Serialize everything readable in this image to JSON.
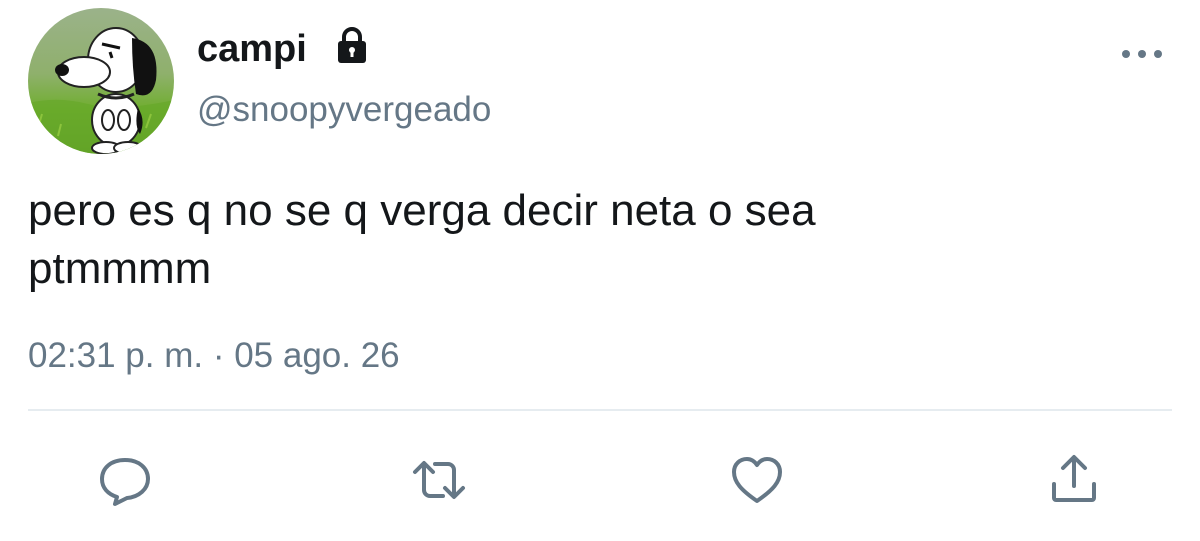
{
  "user": {
    "display_name": "campi",
    "handle": "@snoopyvergeado",
    "protected": true,
    "avatar": "snoopy-avatar"
  },
  "tweet": {
    "text": "pero es q no se q verga decir neta o sea\nptmmmm",
    "timestamp": "02:31 p. m. · 05 ago. 26"
  },
  "actions": {
    "icons": [
      "reply-icon",
      "retweet-icon",
      "like-icon",
      "share-icon"
    ]
  },
  "colors": {
    "primary_text": "#14171a",
    "secondary_text": "#657786",
    "divider": "#e6ecf0"
  }
}
